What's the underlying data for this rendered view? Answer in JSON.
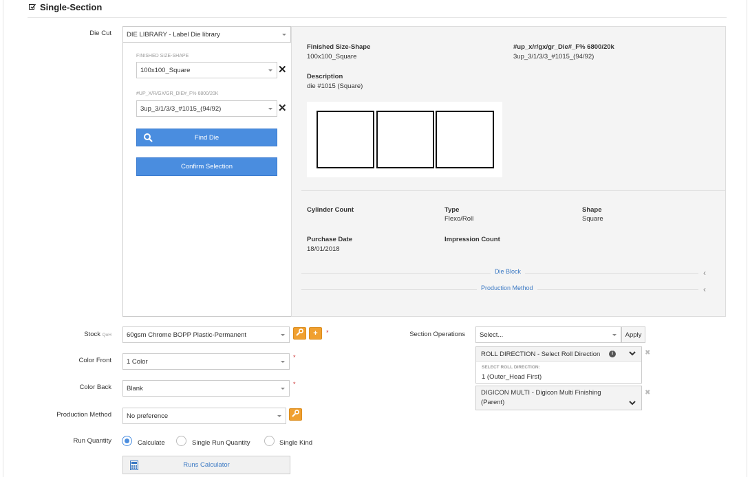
{
  "section": {
    "title": "Single-Section"
  },
  "die_cut": {
    "label": "Die Cut",
    "value": "DIE LIBRARY - Label Die library",
    "finished_size_label": "FINISHED SIZE-SHAPE",
    "finished_size_value": "100x100_Square",
    "up_label": "#UP_X/R/GX/GR_DIE#_F% 6800/20K",
    "up_value": "3up_3/1/3/3_#1015_(94/92)",
    "find_die": "Find Die",
    "confirm": "Confirm Selection"
  },
  "details": {
    "finished_size_title": "Finished Size-Shape",
    "finished_size_value": "100x100_Square",
    "up_title": "#up_x/r/gx/gr_Die#_F% 6800/20k",
    "up_value": "3up_3/1/3/3_#1015_(94/92)",
    "description_title": "Description",
    "description_value": "die #1015 (Square)",
    "cylinder_count_title": "Cylinder Count",
    "type_title": "Type",
    "type_value": "Flexo/Roll",
    "shape_title": "Shape",
    "shape_value": "Square",
    "purchase_date_title": "Purchase Date",
    "purchase_date_value": "18/01/2018",
    "impression_count_title": "Impression Count",
    "die_block_link": "Die Block",
    "production_method_link": "Production Method"
  },
  "form": {
    "stock_label": "Stock",
    "stock_qoh": "QoH",
    "stock_value": "60gsm Chrome BOPP Plastic-Permanent",
    "color_front_label": "Color Front",
    "color_front_value": "1 Color",
    "color_back_label": "Color Back",
    "color_back_value": "Blank",
    "production_method_label": "Production Method",
    "production_method_value": "No preference",
    "run_quantity_label": "Run Quantity",
    "run_options": [
      "Calculate",
      "Single Run Quantity",
      "Single Kind"
    ],
    "runs_calculator": "Runs Calculator",
    "required_mark": "*"
  },
  "operations": {
    "label": "Section Operations",
    "select_placeholder": "Select...",
    "apply": "Apply",
    "roll_direction_title": "ROLL DIRECTION - Select Roll Direction",
    "roll_direction_sublabel": "SELECT ROLL DIRECTION:",
    "roll_direction_value": "1 (Outer_Head First)",
    "digicon_line1": "DIGICON MULTI - Digicon Multi Finishing",
    "digicon_line2": "(Parent)"
  },
  "colors": {
    "accent_blue": "#4a8ddf",
    "orange": "#f0a030",
    "link": "#3a78c3"
  }
}
